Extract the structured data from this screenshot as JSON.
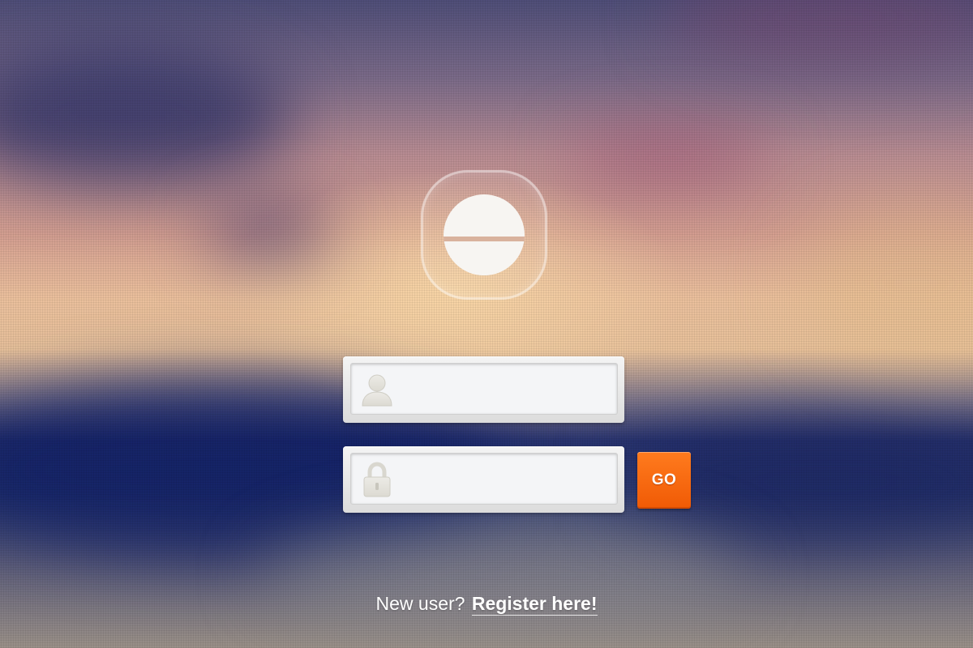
{
  "background": {
    "description_colors": [
      "#2c3b72",
      "#d49f91",
      "#eabf9c",
      "#4f4e78"
    ]
  },
  "logo": {
    "icon": "smiley-face-icon",
    "face_color": "#f7f5f2",
    "accent_color": "#e1b59b"
  },
  "login": {
    "username": {
      "icon": "user-icon",
      "value": "",
      "placeholder": ""
    },
    "password": {
      "icon": "lock-icon",
      "value": "",
      "placeholder": ""
    },
    "submit_label": "GO",
    "submit_color": "#f26a0c"
  },
  "register": {
    "prompt": "New user?",
    "link_label": "Register here!"
  }
}
